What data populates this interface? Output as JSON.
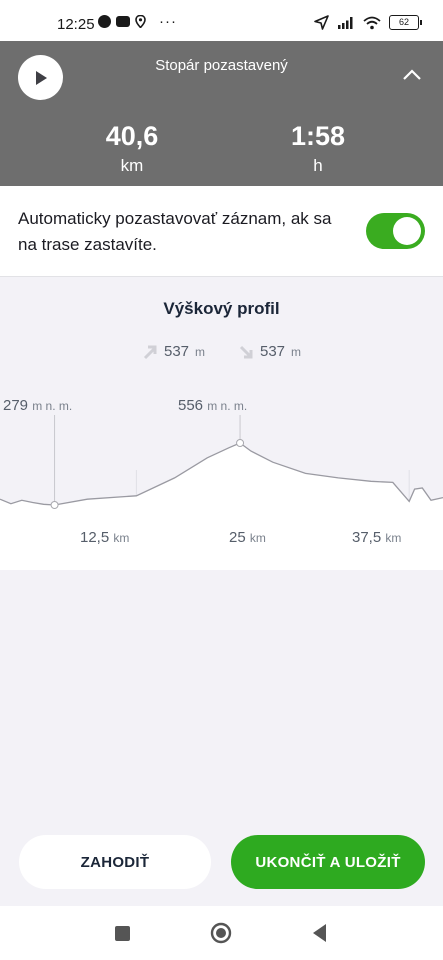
{
  "status_bar": {
    "time": "12:25",
    "more": "···",
    "battery": "62",
    "icons": [
      "messenger-icon",
      "youtube-icon",
      "location-icon",
      "navigation-icon",
      "signal-icon",
      "wifi-icon",
      "battery-icon"
    ]
  },
  "header": {
    "title": "Stopár pozastavený",
    "distance_value": "40,6",
    "distance_unit": "km",
    "time_value": "1:58",
    "time_unit": "h",
    "background": "#6e6e6e"
  },
  "autopause": {
    "text": "Automaticky pozastavovať záznam, ak sa na trase zastavíte.",
    "enabled": true,
    "toggle_color": "#3aac20"
  },
  "profile": {
    "title": "Výškový profil",
    "ascent_value": "537",
    "ascent_unit": "m",
    "descent_value": "537",
    "descent_unit": "m",
    "min_value": "279",
    "min_unit": "m n. m.",
    "max_value": "556",
    "max_unit": "m n. m.",
    "km_ticks": [
      {
        "value": "12,5",
        "unit": "km"
      },
      {
        "value": "25",
        "unit": "km"
      },
      {
        "value": "37,5",
        "unit": "km"
      }
    ]
  },
  "chart_data": {
    "type": "area",
    "title": "Výškový profil",
    "xlabel": "km",
    "ylabel": "m n. m.",
    "x": [
      0,
      1,
      2,
      3,
      4,
      5,
      8,
      12.5,
      16,
      19,
      21,
      22,
      23,
      25,
      28,
      31,
      34,
      36,
      37.5,
      38,
      38.7,
      39.5,
      40.6
    ],
    "y": [
      305,
      285,
      300,
      290,
      282,
      279,
      305,
      320,
      400,
      490,
      535,
      556,
      520,
      470,
      420,
      400,
      385,
      380,
      295,
      350,
      355,
      300,
      312
    ],
    "ylim": [
      279,
      556
    ],
    "xlim": [
      0,
      40.6
    ],
    "grid": false,
    "line_color": "#9a9aa2"
  },
  "actions": {
    "discard_label": "ZAHODIŤ",
    "save_label": "UKONČIŤ A ULOŽIŤ",
    "save_color": "#2eaa20"
  }
}
